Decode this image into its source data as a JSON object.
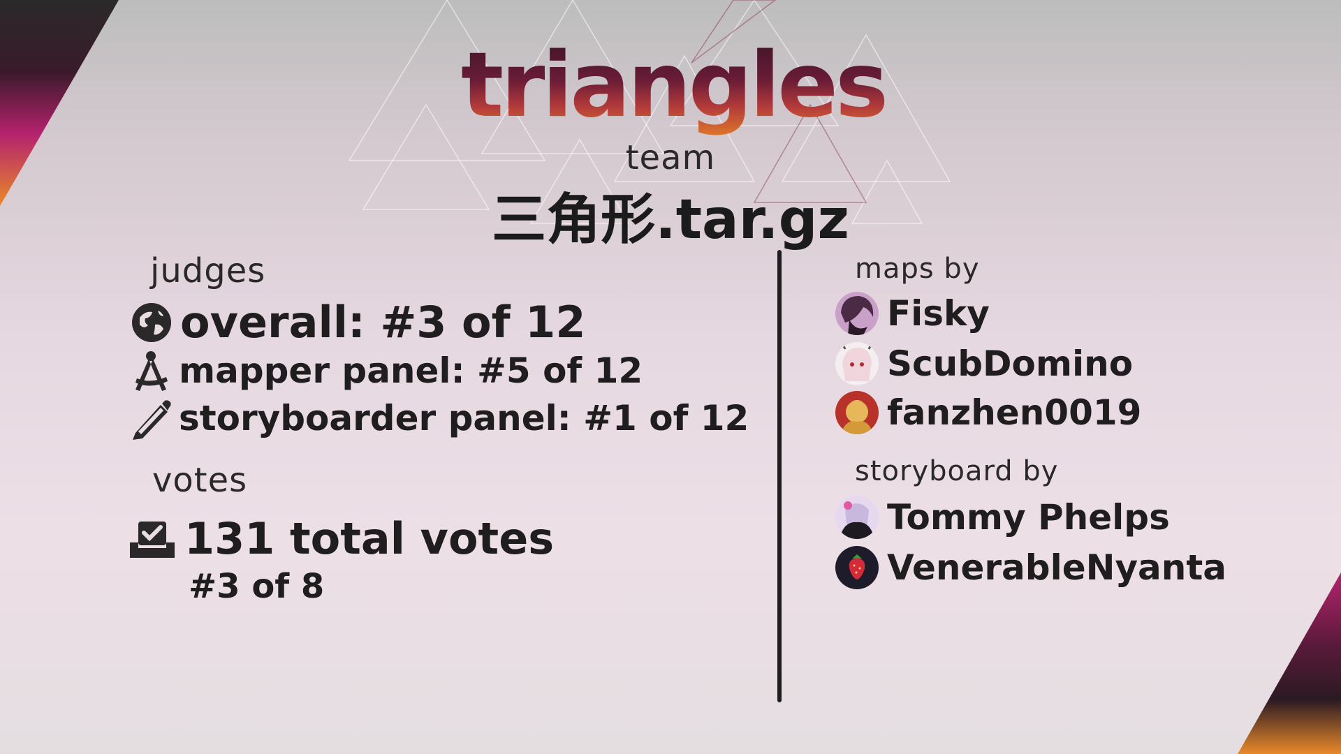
{
  "logo": {
    "text": "triangles"
  },
  "team": {
    "label": "team",
    "name": "三角形.tar.gz"
  },
  "judges": {
    "label": "judges",
    "overall": "overall: #3 of 12",
    "mapper_panel": "mapper panel: #5 of 12",
    "storyboarder_panel": "storyboarder panel: #1 of 12"
  },
  "votes": {
    "label": "votes",
    "total": "131 total votes",
    "rank": "#3 of 8"
  },
  "credits": {
    "maps_label": "maps by",
    "mappers": [
      {
        "name": "Fisky",
        "avatar_color": "#5a2f4f"
      },
      {
        "name": "ScubDomino",
        "avatar_color": "#f2e6ea"
      },
      {
        "name": "fanzhen0019",
        "avatar_color": "#c98a2a"
      }
    ],
    "storyboard_label": "storyboard by",
    "storyboarders": [
      {
        "name": "Tommy Phelps",
        "avatar_color": "#d9c8e8"
      },
      {
        "name": "VenerableNyanta",
        "avatar_color": "#1e1c2a"
      }
    ]
  },
  "colors": {
    "accent_dark": "#3a1428",
    "accent_magenta": "#b5226e",
    "accent_orange": "#e8892a"
  },
  "icons": {
    "overall": "globe-icon",
    "mapper": "compass-icon",
    "storyboarder": "pencil-icon",
    "votes": "ballot-box-icon"
  }
}
